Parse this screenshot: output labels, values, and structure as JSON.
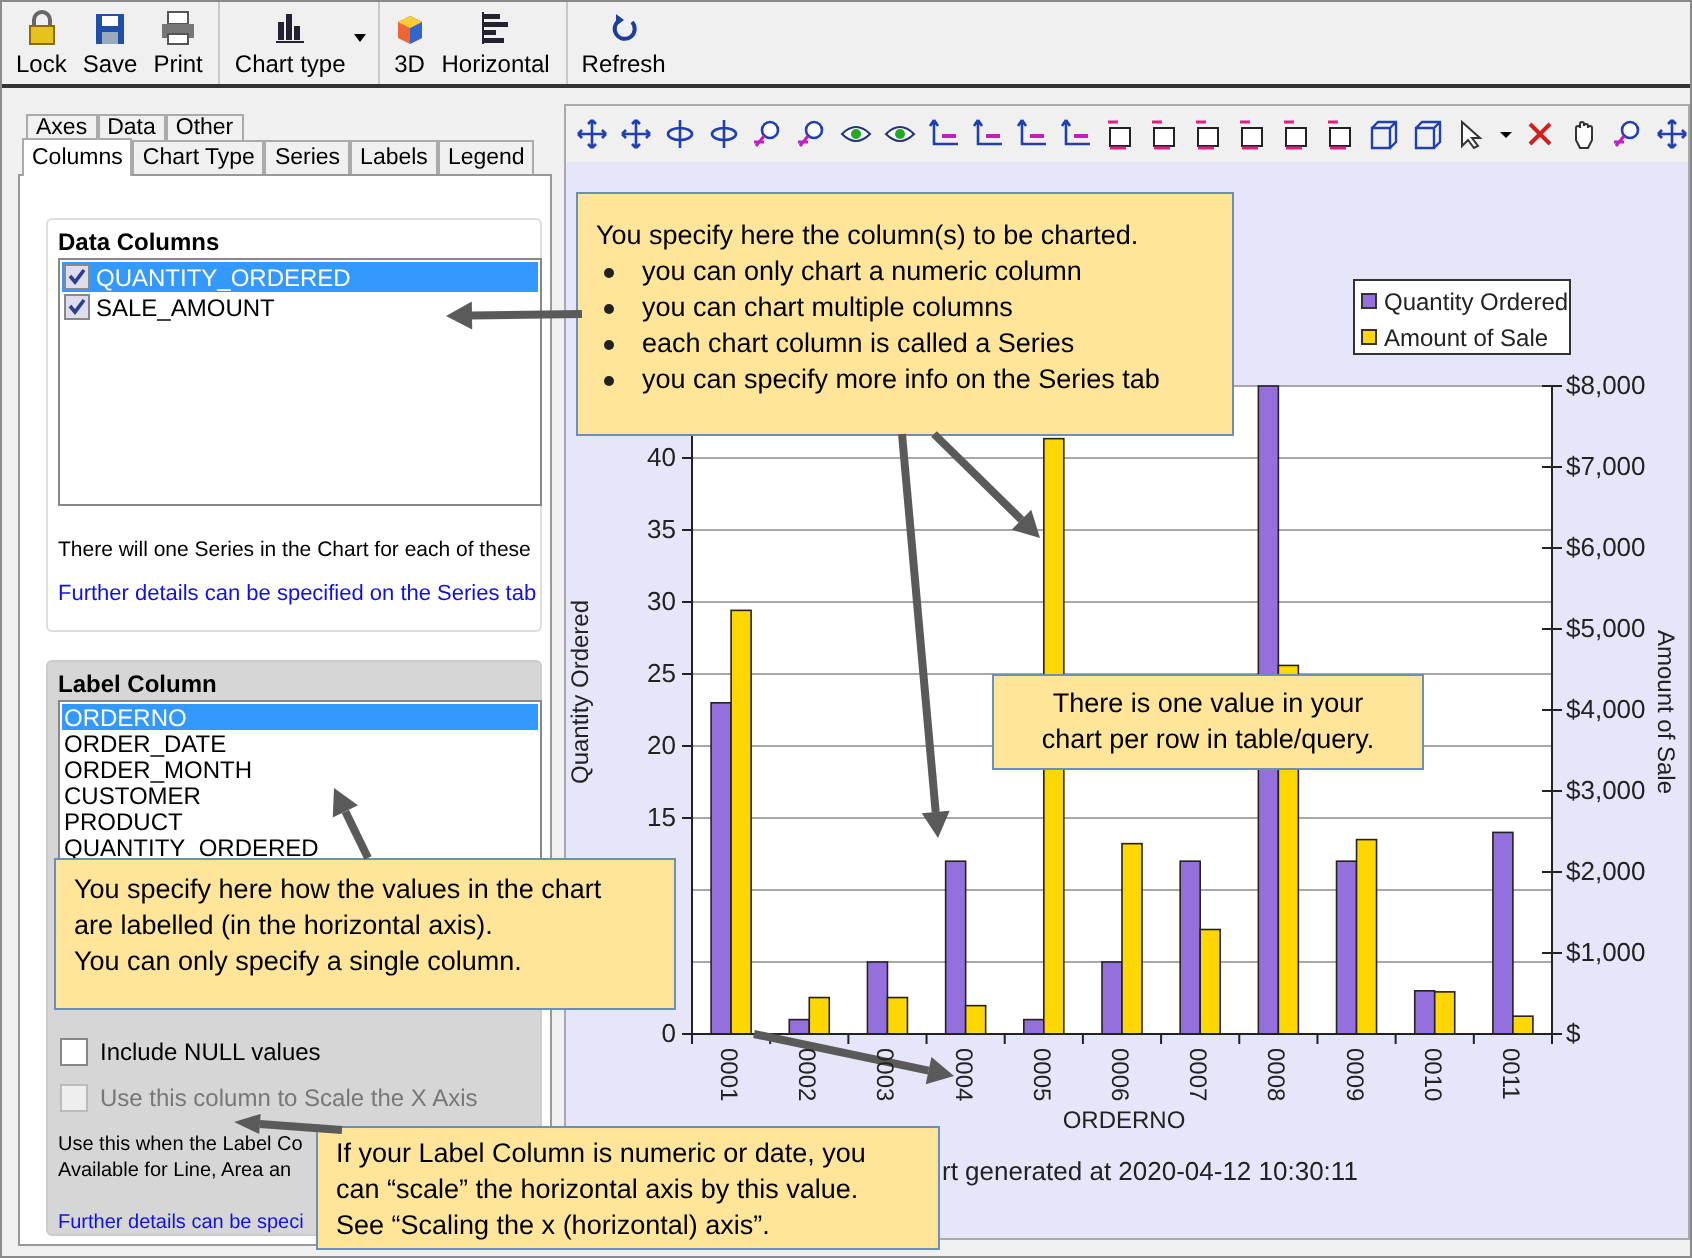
{
  "toolbar": {
    "buttons": [
      {
        "label": "Lock",
        "kind": "lock",
        "separator_before": false,
        "dropdown": false
      },
      {
        "label": "Save",
        "kind": "save",
        "separator_before": false,
        "dropdown": false
      },
      {
        "label": "Print",
        "kind": "print",
        "separator_before": false,
        "dropdown": false
      },
      {
        "label": "Chart type",
        "kind": "chart",
        "separator_before": true,
        "dropdown": true
      },
      {
        "label": "3D",
        "kind": "cube",
        "separator_before": true,
        "dropdown": false
      },
      {
        "label": "Horizontal",
        "kind": "horizontal",
        "separator_before": false,
        "dropdown": false
      },
      {
        "label": "Refresh",
        "kind": "refresh",
        "separator_before": true,
        "dropdown": false
      }
    ]
  },
  "tabs": {
    "back_row": [
      {
        "label": "Axes",
        "selected": false
      },
      {
        "label": "Data",
        "selected": false
      },
      {
        "label": "Other",
        "selected": false
      }
    ],
    "front_row": [
      {
        "label": "Columns",
        "selected": true
      },
      {
        "label": "Chart Type",
        "selected": false
      },
      {
        "label": "Series",
        "selected": false
      },
      {
        "label": "Labels",
        "selected": false
      },
      {
        "label": "Legend",
        "selected": false
      }
    ]
  },
  "data_columns": {
    "title": "Data Columns",
    "items": [
      {
        "label": "QUANTITY_ORDERED",
        "checked": true,
        "selected": true
      },
      {
        "label": "SALE_AMOUNT",
        "checked": true,
        "selected": false
      }
    ],
    "note": "There will one Series in the Chart for each of these",
    "link": "Further details can be specified on the Series tab"
  },
  "label_column": {
    "title": "Label Column",
    "items": [
      {
        "label": "ORDERNO",
        "selected": true
      },
      {
        "label": "ORDER_DATE",
        "selected": false
      },
      {
        "label": "ORDER_MONTH",
        "selected": false
      },
      {
        "label": "CUSTOMER",
        "selected": false
      },
      {
        "label": "PRODUCT",
        "selected": false
      },
      {
        "label": "QUANTITY_ORDERED",
        "selected": false
      }
    ],
    "options": [
      {
        "label": "Include NULL values",
        "checked": false,
        "disabled": false
      },
      {
        "label": "Use this column to Scale the X Axis",
        "checked": false,
        "disabled": true
      }
    ],
    "note_lines": [
      "Use this when the Label Co",
      "Available for Line, Area an"
    ],
    "link": "Further details can be speci"
  },
  "chart": {
    "footer": "rt generated at 2020-04-12 10:30:11",
    "chart_data": {
      "type": "bar",
      "xlabel": "ORDERNO",
      "ylabel": "Quantity Ordered",
      "categories": [
        "0001",
        "0002",
        "0003",
        "0004",
        "0005",
        "0006",
        "0007",
        "0008",
        "0009",
        "0010",
        "0011"
      ],
      "series": [
        {
          "name": "Quantity Ordered",
          "color": "#9370db",
          "values": [
            23,
            1,
            5,
            12,
            1,
            5,
            12,
            45,
            12,
            3,
            14
          ]
        },
        {
          "name": "Amount of Sale",
          "color": "#ffd700",
          "axis": "y2",
          "values": [
            5230,
            450,
            450,
            350,
            7350,
            2350,
            1290,
            4550,
            2400,
            520,
            220
          ]
        }
      ],
      "grid": true,
      "legend": true,
      "ylim": [
        0,
        45
      ],
      "yticks": [
        0,
        15,
        20,
        25,
        30,
        35,
        40
      ],
      "y2label": "Amount of Sale",
      "y2lim": [
        0,
        8000
      ],
      "y2ticks": [
        {
          "value": 0,
          "label": "$"
        },
        {
          "value": 1000,
          "label": "$1,000"
        },
        {
          "value": 2000,
          "label": "$2,000"
        },
        {
          "value": 3000,
          "label": "$3,000"
        },
        {
          "value": 4000,
          "label": "$4,000"
        },
        {
          "value": 5000,
          "label": "$5,000"
        },
        {
          "value": 6000,
          "label": "$6,000"
        },
        {
          "value": 7000,
          "label": "$7,000"
        },
        {
          "value": 8000,
          "label": "$8,000"
        }
      ]
    }
  },
  "callouts": [
    {
      "kind": "bullets",
      "heading": "You specify here the column(s) to be charted.",
      "bullets": [
        "you can only chart a numeric column",
        "you can chart multiple columns",
        "each chart column is called a Series",
        "you can specify more info on the Series tab"
      ]
    },
    {
      "kind": "plain",
      "lines": [
        "You specify here how the values in the chart",
        "are labelled (in the horizontal axis).",
        "You can only specify a single column."
      ]
    },
    {
      "kind": "centered",
      "lines": [
        "There is one value in your",
        "chart per row in table/query."
      ]
    },
    {
      "kind": "plain",
      "lines": [
        "If your Label Column is numeric or date, you",
        "can “scale” the horizontal axis by this value.",
        "See “Scaling the x (horizontal) axis”."
      ]
    }
  ]
}
